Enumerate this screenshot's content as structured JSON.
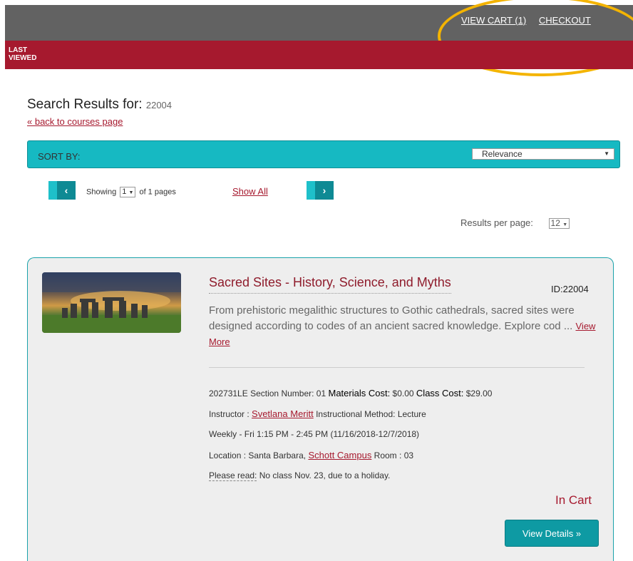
{
  "header": {
    "view_cart": "VIEW CART (1)",
    "checkout": "CHECKOUT",
    "last_viewed_1": "LAST",
    "last_viewed_2": "VIEWED"
  },
  "search": {
    "heading": "Search Results for:",
    "query": "22004",
    "back_link": "« back to courses page"
  },
  "sort": {
    "label": "SORT BY:",
    "selected": "Relevance"
  },
  "pagination": {
    "prev_icon": "‹",
    "next_icon": "›",
    "showing": "Showing",
    "page": "1",
    "of_pages": "of 1 pages",
    "show_all": "Show All",
    "results_per_page_label": "Results per page:",
    "results_per_page": "12"
  },
  "course": {
    "title": "Sacred Sites - History, Science, and Myths",
    "id": "ID:22004",
    "description": "From prehistoric megalithic structures to Gothic cathedrals, sacred sites were designed according to codes of an ancient sacred knowledge. Explore cod ...",
    "view_more": "View More",
    "code": "202731LE",
    "section_label": "Section Number:",
    "section": "01",
    "materials_label": "Materials Cost:",
    "materials": "$0.00",
    "class_cost_label": "Class Cost:",
    "class_cost": "$29.00",
    "instructor_label": "Instructor :",
    "instructor": "Svetlana Meritt",
    "method_label": "Instructional Method:",
    "method": "Lecture",
    "schedule": "Weekly - Fri 1:15 PM - 2:45 PM (11/16/2018-12/7/2018)",
    "location_label": "Location :",
    "location": "Santa Barbara,",
    "campus": "Schott Campus",
    "room_label": "Room :",
    "room": "03",
    "note_label": "Please read:",
    "note": "No class Nov. 23, due to a holiday.",
    "in_cart": "In Cart",
    "view_details": "View Details »"
  },
  "colors": {
    "brand_red": "#a6192e",
    "teal": "#16b9c2",
    "highlight": "#f4b400"
  }
}
